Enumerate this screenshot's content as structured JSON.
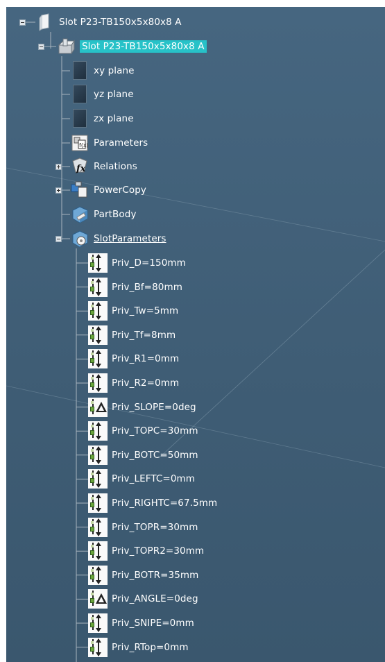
{
  "tree": {
    "root": {
      "label": "Slot P23-TB150x5x80x8 A",
      "icon": "document-icon"
    },
    "part": {
      "label": "Slot P23-TB150x5x80x8 A",
      "icon": "part-icon",
      "selected": true
    },
    "planes": [
      {
        "label": "xy plane",
        "icon": "plane-icon"
      },
      {
        "label": "yz plane",
        "icon": "plane-icon"
      },
      {
        "label": "zx plane",
        "icon": "plane-icon"
      }
    ],
    "nodes": {
      "parameters": {
        "label": "Parameters",
        "icon": "parameters-icon"
      },
      "relations": {
        "label": "Relations",
        "icon": "relations-icon"
      },
      "powercopy": {
        "label": "PowerCopy",
        "icon": "powercopy-icon"
      },
      "partbody": {
        "label": "PartBody",
        "icon": "partbody-icon"
      },
      "slotparameters": {
        "label": "SlotParameters",
        "icon": "parameter-set-icon"
      }
    },
    "slot_params": [
      {
        "label": "Priv_D=150mm",
        "kind": "length"
      },
      {
        "label": "Priv_Bf=80mm",
        "kind": "length"
      },
      {
        "label": "Priv_Tw=5mm",
        "kind": "length"
      },
      {
        "label": "Priv_Tf=8mm",
        "kind": "length"
      },
      {
        "label": "Priv_R1=0mm",
        "kind": "length"
      },
      {
        "label": "Priv_R2=0mm",
        "kind": "length"
      },
      {
        "label": "Priv_SLOPE=0deg",
        "kind": "angle"
      },
      {
        "label": "Priv_TOPC=30mm",
        "kind": "length"
      },
      {
        "label": "Priv_BOTC=50mm",
        "kind": "length"
      },
      {
        "label": "Priv_LEFTC=0mm",
        "kind": "length"
      },
      {
        "label": "Priv_RIGHTC=67.5mm",
        "kind": "length"
      },
      {
        "label": "Priv_TOPR=30mm",
        "kind": "length"
      },
      {
        "label": "Priv_TOPR2=30mm",
        "kind": "length"
      },
      {
        "label": "Priv_BOTR=35mm",
        "kind": "length"
      },
      {
        "label": "Priv_ANGLE=0deg",
        "kind": "angle"
      },
      {
        "label": "Priv_SNIPE=0mm",
        "kind": "length"
      },
      {
        "label": "Priv_RTop=0mm",
        "kind": "length"
      }
    ]
  },
  "colors": {
    "background": "#42617a",
    "selection": "#27c2c8",
    "tree_line": "#a8b4be",
    "text": "#ffffff"
  }
}
